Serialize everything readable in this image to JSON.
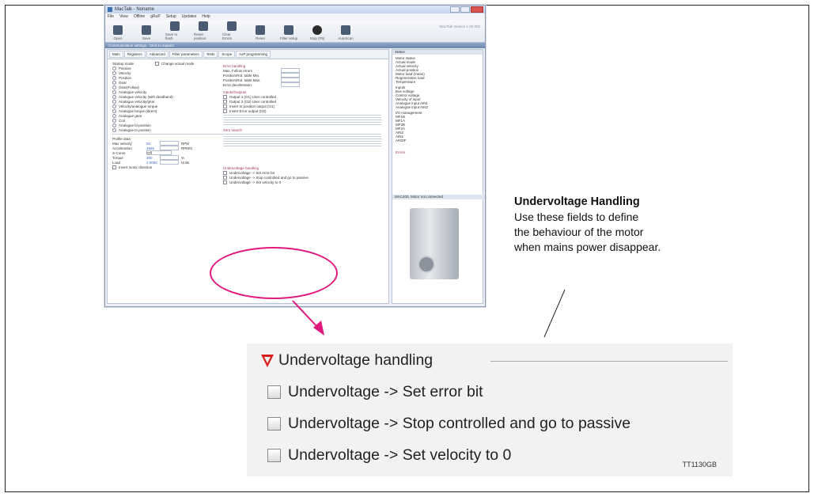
{
  "app": {
    "title": "MacTalk - Noname",
    "version": "MacTalk Version 1.00.000",
    "menu": [
      "File",
      "View",
      "Offline",
      "gRuP",
      "Setup",
      "Updates",
      "Help"
    ],
    "toolbar": [
      "Open",
      "Save",
      "Save to flash",
      "Reset position",
      "Clear Errors",
      "Reset",
      "Filter setup",
      "Stop (F9)",
      "AutoScan"
    ],
    "comm_bar": "Communication settings - Click to expand",
    "tabs": [
      "Main",
      "Registers",
      "Advanced",
      "Filter parameters",
      "Tests",
      "Scope",
      "AxP programming"
    ],
    "startup_label": "Startup mode",
    "change_actual": "Change actual mode",
    "startup_modes": [
      "Passive",
      "Velocity",
      "Position",
      "Gear",
      "Gear(Follow)",
      "Analogue velocity",
      "Analogue velocity (with deadband)",
      "Analogue velocity/gear",
      "Velocity/analogue torque",
      "Analogue torque (direct)",
      "Analogue gear",
      "Coil",
      "Analogue bi-position",
      "Analogue to position"
    ],
    "profile_label": "Profile data",
    "profile": [
      {
        "label": "Max velocity",
        "value": "50",
        "unit": "RPM"
      },
      {
        "label": "Acceleration",
        "value": "4665",
        "unit": "RPM/S"
      },
      {
        "label": "S-Curve",
        "value": "Off",
        "unit": ""
      },
      {
        "label": "Torque",
        "value": "300",
        "unit": "%"
      },
      {
        "label": "Load",
        "value": "1.0000",
        "unit": "Units"
      }
    ],
    "invert_dir": "Invert motor direction",
    "error_label": "Error handling",
    "error_fields": [
      "Max. Follow errors",
      "Position/Rot. table Min.",
      "Position/Rot. table Max.",
      "Error deceleration"
    ],
    "io_label": "Inputs/Outputs",
    "io_items": [
      "Output 1 (O1) User controlled",
      "Output 2 (O2) User controlled",
      "Invert In position output (O1)",
      "Invert Error output (O2)"
    ],
    "zero_label": "Zero search",
    "underv_small": [
      "Undervoltage handling",
      "Undervoltage -> Set error bit",
      "Undervoltage -> Stop controlled and go to passive",
      "Undervoltage -> Set velocity to 0"
    ],
    "status_label": "Status",
    "motor_status_label": "Motor status",
    "status_rows": [
      "Actual mode",
      "Actual velocity",
      "Actual position",
      "Motor load (mean)",
      "Regenerative load",
      "Temperature"
    ],
    "inputs_label": "Inputs",
    "input_rows": [
      "Bus voltage",
      "Control voltage",
      "Velocity of input",
      "Analogue input AIN1",
      "Analogue input AIN2"
    ],
    "io_mgmt_label": "I/O management",
    "io_mgmt": [
      "MF1B",
      "MF1A",
      "MF2B",
      "MF2A",
      "AIN2",
      "AIN1",
      "AINDF"
    ],
    "errors_label": "Errors",
    "motor_label": "MAC400, Motor not connected"
  },
  "callout": {
    "heading": "Undervoltage Handling",
    "lines": [
      "Use these fields to define",
      "the behaviour of the motor",
      "when mains power disappear."
    ]
  },
  "zoom": {
    "heading": "Undervoltage handling",
    "items": [
      "Undervoltage -> Set error bit",
      "Undervoltage -> Stop controlled and go to passive",
      "Undervoltage -> Set velocity to 0"
    ],
    "code": "TT1130GB"
  },
  "colors": {
    "accent": "#e0197d",
    "warning": "#d91c1c"
  }
}
